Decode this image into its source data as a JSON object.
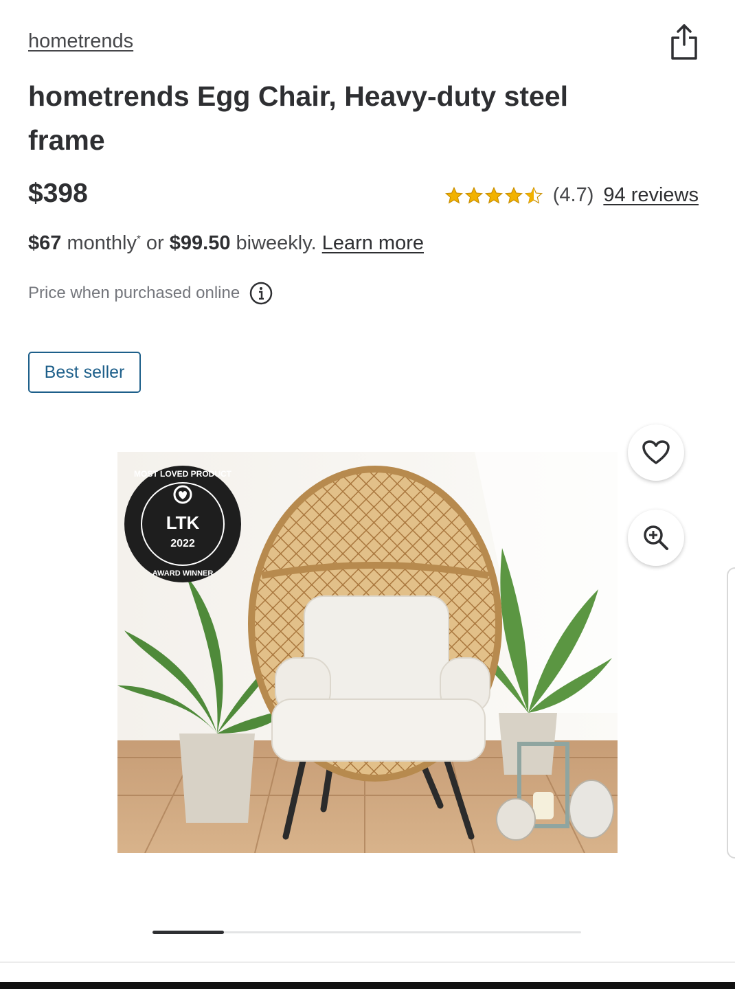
{
  "brand": {
    "label": "hometrends"
  },
  "product": {
    "title": "hometrends Egg Chair, Heavy-duty steel frame",
    "price": "$398",
    "rating": {
      "value": 4.7,
      "text": "(4.7)",
      "stars_filled": 4.5,
      "max": 5,
      "reviews_label": "94 reviews",
      "star_color": "#f2b200"
    },
    "installment": {
      "monthly_amount": "$67",
      "monthly_text": " monthly",
      "asterisk": "*",
      "or_text": " or ",
      "biweekly_amount": "$99.50",
      "biweekly_text": " biweekly.",
      "learn_more": "Learn more"
    },
    "price_note": "Price when purchased online",
    "badge": "Best seller",
    "image": {
      "award_badge": {
        "top": "MOST LOVED PRODUCT",
        "brand": "LTK",
        "year": "2022",
        "bottom": "AWARD WINNER"
      }
    }
  },
  "actions": {
    "share_icon": "share-icon",
    "favorite_icon": "heart-icon",
    "zoom_icon": "zoom-in-icon",
    "info_icon": "info-icon"
  },
  "carousel": {
    "current": 1,
    "total": 6
  },
  "colors": {
    "text": "#2e2f32",
    "badge_border": "#1d5f8a",
    "star": "#f2b200"
  }
}
